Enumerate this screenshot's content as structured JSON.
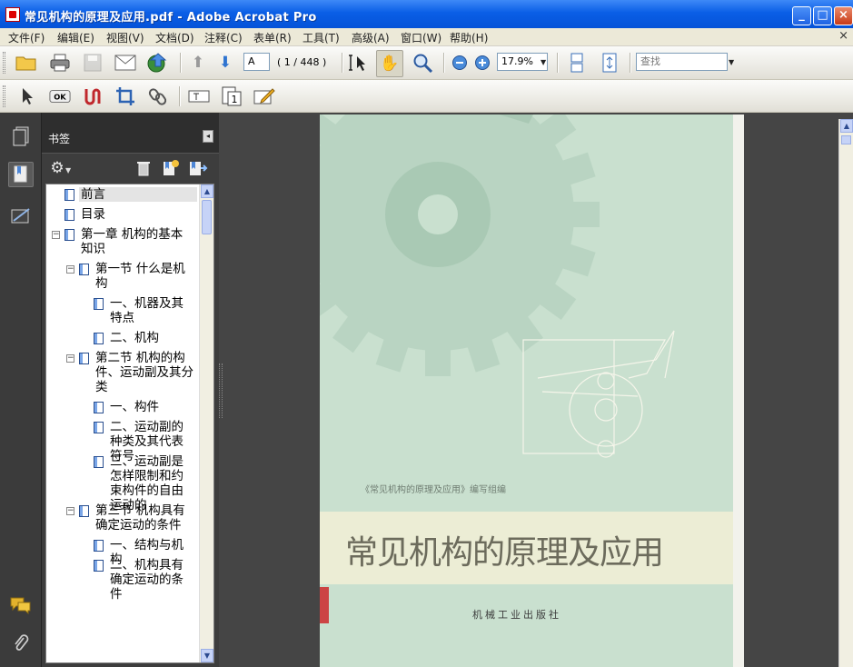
{
  "window": {
    "title": "常见机构的原理及应用.pdf - Adobe Acrobat Pro",
    "minimize": "_",
    "maximize": "□",
    "close": "×"
  },
  "menu": [
    "文件(F)",
    "编辑(E)",
    "视图(V)",
    "文档(D)",
    "注释(C)",
    "表单(R)",
    "工具(T)",
    "高级(A)",
    "窗口(W)",
    "帮助(H)"
  ],
  "menu_close": "×",
  "toolbar": {
    "page_label": "A",
    "page_count": "( 1 / 448 )",
    "zoom": "17.9%",
    "search_placeholder": "查找"
  },
  "panel": {
    "title": "书签",
    "collapse": "◂"
  },
  "bookmarks": [
    {
      "level": 0,
      "label": "前言",
      "selected": true
    },
    {
      "level": 0,
      "label": "目录"
    },
    {
      "level": 0,
      "label": "第一章  机构的基本知识",
      "expandable": true
    },
    {
      "level": 1,
      "label": "第一节  什么是机构",
      "expandable": true
    },
    {
      "level": 2,
      "label": "一、机器及其特点"
    },
    {
      "level": 2,
      "label": "二、机构"
    },
    {
      "level": 1,
      "label": "第二节  机构的构件、运动副及其分类",
      "expandable": true
    },
    {
      "level": 2,
      "label": "一、构件"
    },
    {
      "level": 2,
      "label": "二、运动副的种类及其代表符号"
    },
    {
      "level": 2,
      "label": "三、运动副是怎样限制和约束构件的自由运动的"
    },
    {
      "level": 1,
      "label": "第三节  机构具有确定运动的条件",
      "expandable": true
    },
    {
      "level": 2,
      "label": "一、结构与机构"
    },
    {
      "level": 2,
      "label": "二、机构具有确定运动的条件"
    }
  ],
  "cover": {
    "editor": "《常见机构的原理及应用》编写组编",
    "title": "常见机构的原理及应用",
    "publisher": "机械工业出版社"
  },
  "colors": {
    "titlebar": "#0a5ee6",
    "workarea": "#454545",
    "cover_green": "#c9e0cf"
  }
}
